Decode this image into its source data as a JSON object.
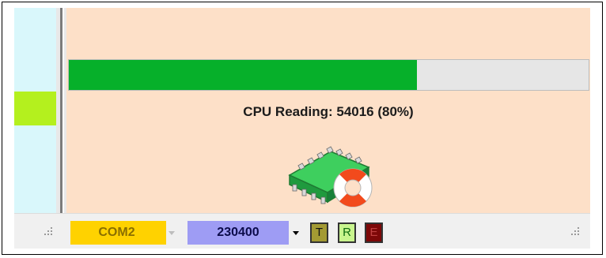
{
  "progress": {
    "label": "CPU Reading: 54016 (80%)",
    "fraction": 0.67
  },
  "status_bar": {
    "port": "COM2",
    "baud": "230400",
    "indicators": {
      "tx": "T",
      "rx": "R",
      "error": "E"
    }
  },
  "colors": {
    "progress_fill": "#06b02a",
    "main_bg": "#fde0c8",
    "left_panel_bg": "#d9f7fb",
    "left_swatch": "#b4f01e",
    "port_bg": "#ffd200",
    "baud_bg": "#9e9cf4",
    "tx_bg": "#a39a33",
    "rx_bg": "#c9f58e",
    "error_bg": "#7d0808"
  },
  "icons": {
    "app": "chip-lifebuoy-icon"
  }
}
